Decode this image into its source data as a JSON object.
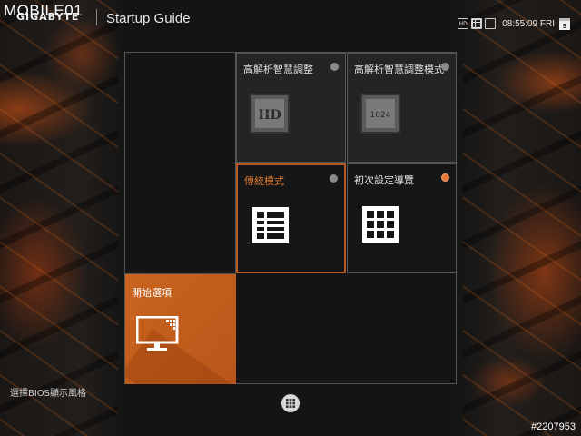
{
  "watermark": "MOBILE01",
  "header": {
    "brand": "GIGABYTE",
    "title": "Startup Guide",
    "status": {
      "icons": [
        "hd-icon",
        "grid-icon",
        "window-icon"
      ],
      "icon_labels": [
        "HD",
        "",
        ""
      ],
      "time": "08:55:09 FRI",
      "date_day": "9"
    }
  },
  "tiles": [
    {
      "id": "smart-hd",
      "label": "高解析智慧調整",
      "icon": "hd-icon",
      "icon_text": "HD",
      "selected": false,
      "radio": "off"
    },
    {
      "id": "smart-hd-mode",
      "label": "高解析智慧調整模式",
      "icon": "1024-icon",
      "icon_text": "1024",
      "selected": false,
      "radio": "off"
    },
    {
      "id": "classic",
      "label": "傳統模式",
      "icon": "list-layout-icon",
      "selected": true,
      "radio": "off"
    },
    {
      "id": "first-setup",
      "label": "初次設定導覽",
      "icon": "grid-layout-icon",
      "selected": false,
      "radio": "on"
    }
  ],
  "start": {
    "label": "開始選項",
    "icon": "monitor-icon"
  },
  "footer": {
    "left_text": "選擇BIOS顯示風格",
    "post_id": "#2207953"
  },
  "colors": {
    "accent": "#c9641f",
    "selected_border": "#b55a22",
    "radio_on": "#e57a3a"
  }
}
